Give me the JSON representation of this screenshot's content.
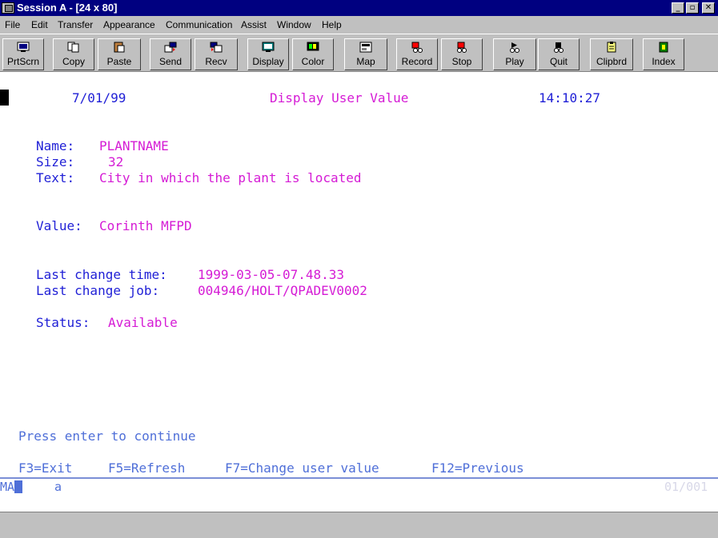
{
  "window": {
    "title": "Session A - [24 x 80]",
    "controls": {
      "minimize": "_",
      "maximize": "▫",
      "close": "✕"
    }
  },
  "menu": [
    "File",
    "Edit",
    "Transfer",
    "Appearance",
    "Communication",
    "Assist",
    "Window",
    "Help"
  ],
  "toolbar": [
    {
      "label": "PrtScrn",
      "icon": "print-screen-icon"
    },
    {
      "label": "Copy",
      "icon": "copy-icon"
    },
    {
      "label": "Paste",
      "icon": "paste-icon"
    },
    {
      "label": "Send",
      "icon": "send-icon"
    },
    {
      "label": "Recv",
      "icon": "receive-icon"
    },
    {
      "label": "Display",
      "icon": "display-icon"
    },
    {
      "label": "Color",
      "icon": "color-icon"
    },
    {
      "label": "Map",
      "icon": "map-icon"
    },
    {
      "label": "Record",
      "icon": "record-icon"
    },
    {
      "label": "Stop",
      "icon": "stop-icon"
    },
    {
      "label": "Play",
      "icon": "play-icon"
    },
    {
      "label": "Quit",
      "icon": "quit-icon"
    },
    {
      "label": "Clipbrd",
      "icon": "clipboard-icon"
    },
    {
      "label": "Index",
      "icon": "index-icon"
    }
  ],
  "screen": {
    "date": "7/01/99",
    "title": "Display User Value",
    "time": "14:10:27",
    "name_label": "Name:",
    "name_value": "PLANTNAME",
    "size_label": "Size:",
    "size_value": "32",
    "text_label": "Text:",
    "text_value": "City in which the plant is located",
    "value_label": "Value:",
    "value_value": "Corinth MFPD",
    "last_change_time_label": "Last change time:",
    "last_change_time_value": "1999-03-05-07.48.33",
    "last_change_job_label": "Last change job:",
    "last_change_job_value": "004946/HOLT/QPADEV0002",
    "status_label": "Status:",
    "status_value": "Available",
    "prompt": "Press enter to continue",
    "fkeys": {
      "f3": "F3=Exit",
      "f5": "F5=Refresh",
      "f7": "F7=Change user value",
      "f12": "F12=Previous"
    }
  },
  "oia": {
    "indicator": "MA",
    "mode": "a",
    "position": "01/001"
  },
  "colors": {
    "field_label": "#1f1fd6",
    "field_value": "#d51bd5",
    "footer": "#4f6fd8",
    "titlebar": "#000080"
  }
}
